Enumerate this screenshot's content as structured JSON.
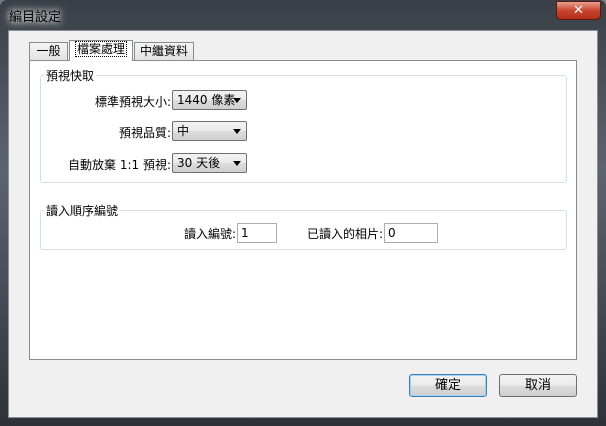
{
  "window": {
    "title": "編目設定",
    "close_label": "✕"
  },
  "tabs": [
    {
      "label": "一般",
      "active": false
    },
    {
      "label": "檔案處理",
      "active": true
    },
    {
      "label": "中繼資料",
      "active": false
    }
  ],
  "preview_cache": {
    "title": "預視快取",
    "standard_size_label": "標準預視大小:",
    "standard_size_value": "1440 像素",
    "quality_label": "預視品質:",
    "quality_value": "中",
    "discard_label": "自動放棄 1:1 預視:",
    "discard_value": "30 天後"
  },
  "import_sequence": {
    "title": "讀入順序編號",
    "import_number_label": "讀入編號:",
    "import_number_value": "1",
    "photos_imported_label": "已讀入的相片:",
    "photos_imported_value": "0"
  },
  "buttons": {
    "ok": "確定",
    "cancel": "取消"
  }
}
